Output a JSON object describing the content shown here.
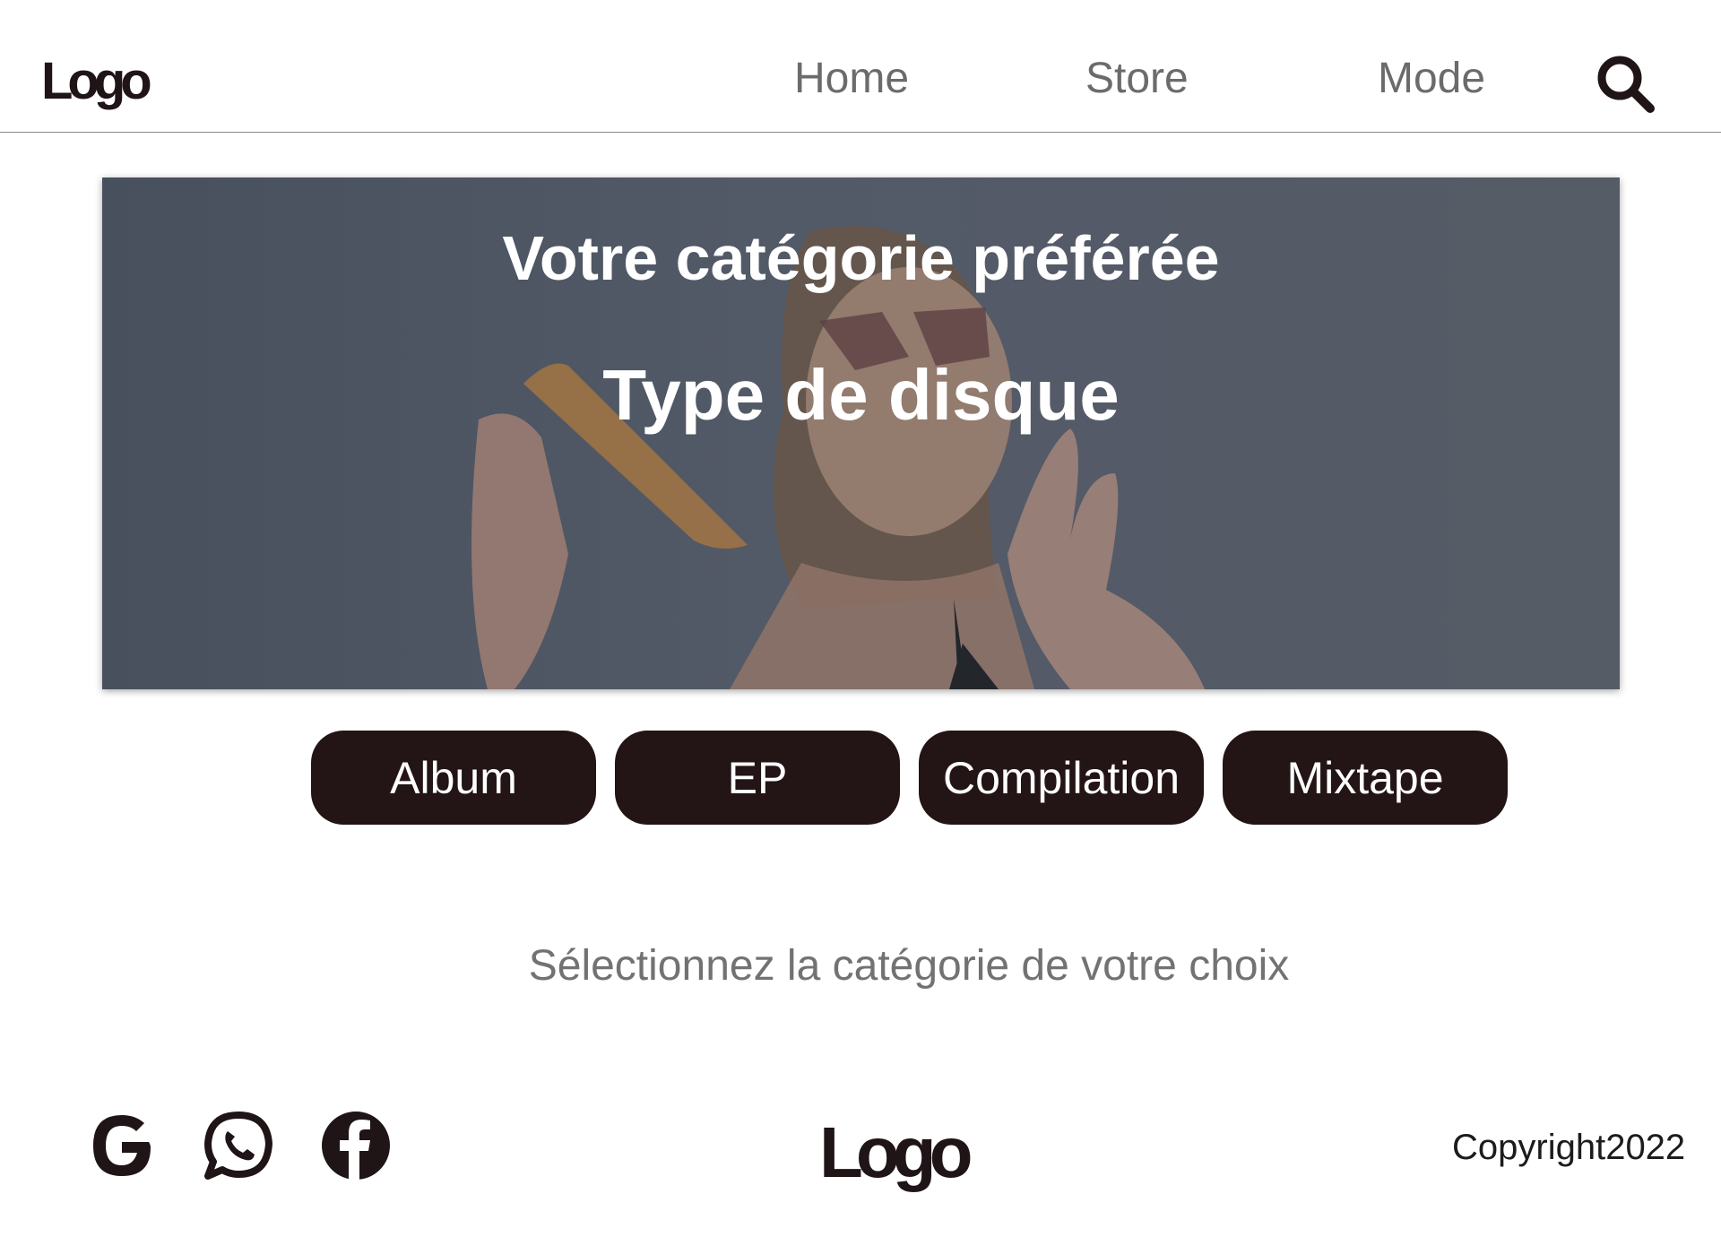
{
  "header": {
    "logo_text": "Logo",
    "nav": [
      {
        "label": "Home"
      },
      {
        "label": "Store"
      },
      {
        "label": "Mode"
      }
    ],
    "search_icon": "search-icon"
  },
  "hero": {
    "title": "Votre catégorie préférée",
    "subtitle": "Type de disque"
  },
  "categories": [
    {
      "label": "Album"
    },
    {
      "label": "EP"
    },
    {
      "label": "Compilation"
    },
    {
      "label": "Mixtape"
    }
  ],
  "helper_text": "Sélectionnez la catégorie de votre choix",
  "footer": {
    "social_icons": [
      "google-icon",
      "whatsapp-icon",
      "facebook-icon"
    ],
    "logo_text": "Logo",
    "copyright": "Copyright2022"
  },
  "colors": {
    "button_bg": "#231416",
    "text_dark": "#1f1416",
    "nav_text": "#6b6b6b"
  }
}
